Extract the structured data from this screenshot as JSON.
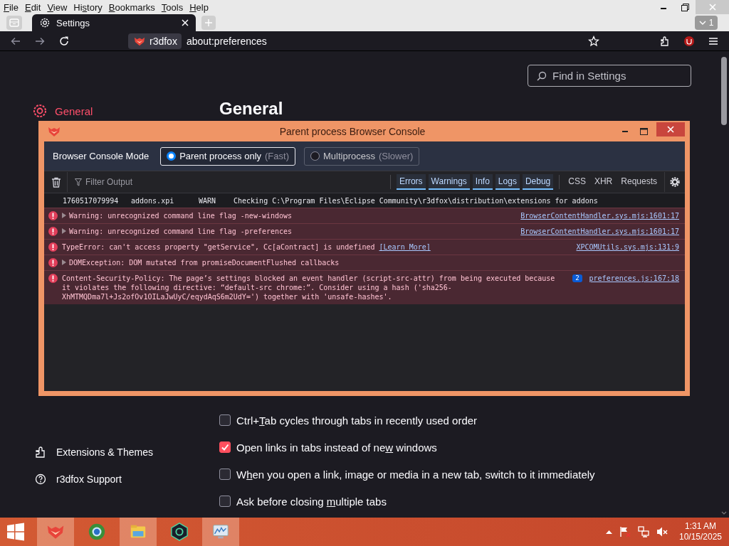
{
  "menu_bar": {
    "items": [
      {
        "key": "F",
        "after": "ile"
      },
      {
        "key": "E",
        "after": "dit"
      },
      {
        "key": "V",
        "after": "iew"
      },
      {
        "before": "Hi",
        "key": "s",
        "after": "tory"
      },
      {
        "key": "B",
        "after": "ookmarks"
      },
      {
        "key": "T",
        "after": "ools"
      },
      {
        "key": "H",
        "after": "elp"
      }
    ]
  },
  "tabs": [
    {
      "label": "Settings",
      "selected": true
    }
  ],
  "tab_count": "1",
  "address_bar": {
    "identity": "r3dfox",
    "url": "about:preferences"
  },
  "search": {
    "placeholder": "Find in Settings"
  },
  "sidebar": {
    "items": [
      {
        "label": "General",
        "selected": true
      }
    ],
    "footer": [
      {
        "label": "Extensions & Themes"
      },
      {
        "label": "r3dfox Support"
      }
    ]
  },
  "heading": "General",
  "options": [
    {
      "before": "Ctrl+",
      "key": "T",
      "after": "ab cycles through tabs in recently used order",
      "checked": false
    },
    {
      "before": "Open links in tabs instead of ne",
      "key": "w",
      "after": " windows",
      "checked": true
    },
    {
      "before": "W",
      "key": "h",
      "after": "en you open a link, image or media in a new tab, switch to it immediately",
      "checked": false
    },
    {
      "before": "Ask before closing ",
      "key": "m",
      "after": "ultiple tabs",
      "checked": false
    }
  ],
  "console": {
    "title": "Parent process Browser Console",
    "mode_label": "Browser Console Mode",
    "modes": [
      {
        "label": "Parent process only",
        "hint": "(Fast)",
        "selected": true
      },
      {
        "label": "Multiprocess",
        "hint": "(Slower)",
        "selected": false
      }
    ],
    "filter": {
      "placeholder": "Filter Output"
    },
    "level_filters": [
      {
        "label": "Errors",
        "selected": true
      },
      {
        "label": "Warnings",
        "selected": true
      },
      {
        "label": "Info",
        "selected": true
      },
      {
        "label": "Logs",
        "selected": true
      },
      {
        "label": "Debug",
        "selected": true
      }
    ],
    "type_filters": [
      {
        "label": "CSS",
        "selected": false
      },
      {
        "label": "XHR",
        "selected": false
      },
      {
        "label": "Requests",
        "selected": false
      }
    ],
    "messages": [
      {
        "kind": "log",
        "timestamp": "1760517079994",
        "source": "addons.xpi",
        "level": "WARN",
        "text": "Checking C:\\Program Files\\Eclipse Community\\r3dfox\\distribution\\extensions for addons"
      },
      {
        "kind": "error",
        "expandable": true,
        "text": "Warning: unrecognized command line flag -new-windows",
        "location": "BrowserContentHandler.sys.mjs:1601:17"
      },
      {
        "kind": "error",
        "expandable": true,
        "text": "Warning: unrecognized command line flag -preferences",
        "location": "BrowserContentHandler.sys.mjs:1601:17"
      },
      {
        "kind": "error",
        "expandable": false,
        "text": "TypeError: can't access property \"getService\", Cc[aContract] is undefined",
        "link": "[Learn More]",
        "location": "XPCOMUtils.sys.mjs:131:9"
      },
      {
        "kind": "error",
        "expandable": true,
        "text": "DOMException: DOM mutated from promiseDocumentFlushed callbacks"
      },
      {
        "kind": "error",
        "expandable": false,
        "text": "Content-Security-Policy: The page’s settings blocked an event handler (script-src-attr) from being executed because it violates the following directive: “default-src chrome:”. Consider using a hash ('sha256-XhMTMQDma7l+Js2ofOv1OILaJwUyC/eqydAqS6m2UdY=') together with 'unsafe-hashes'.",
        "count": "2",
        "location": "preferences.js:167:18"
      }
    ]
  },
  "taskbar": {
    "time": "1:31 AM",
    "date": "10/15/2025"
  }
}
